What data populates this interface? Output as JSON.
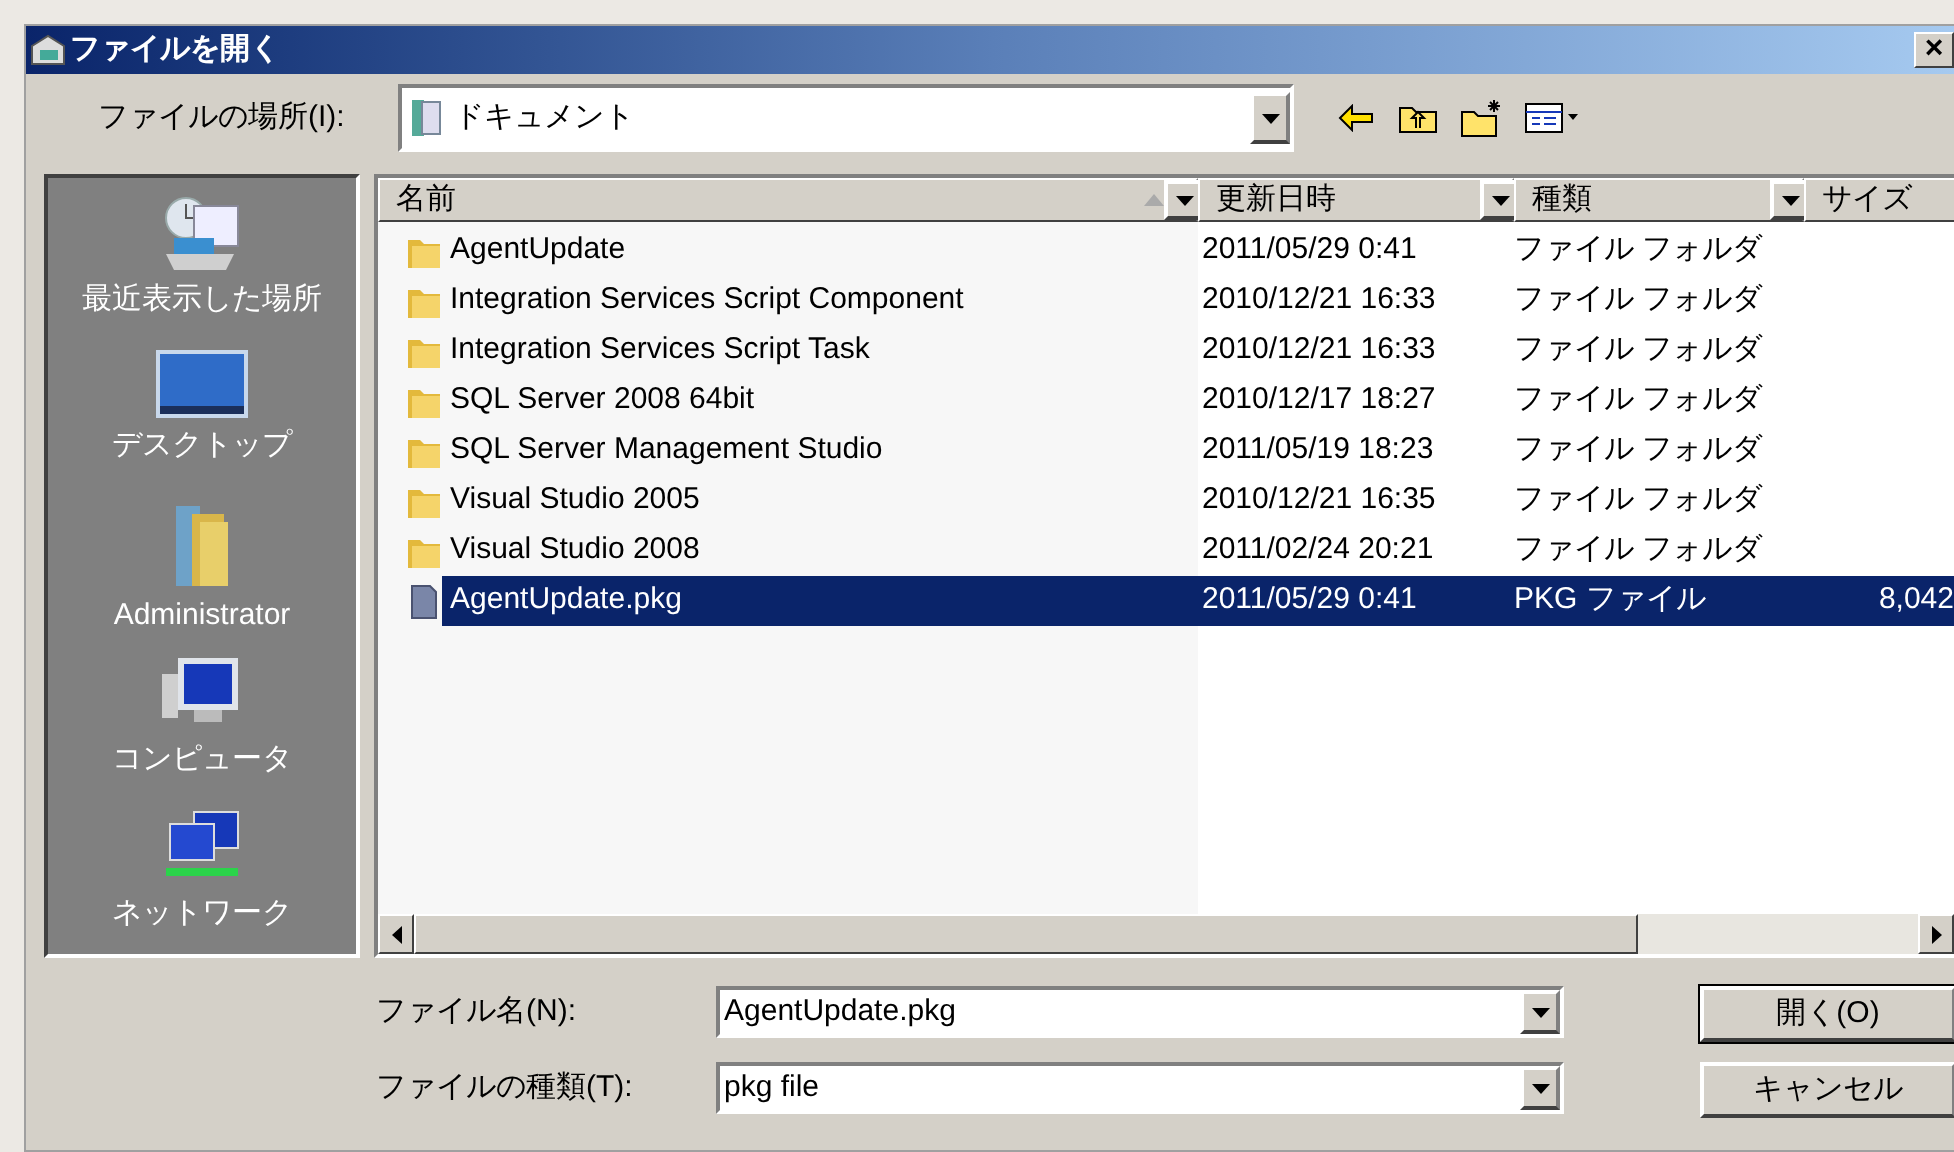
{
  "window": {
    "title": "ファイルを開く",
    "close": "×"
  },
  "location": {
    "label": "ファイルの場所(I):",
    "value": "ドキュメント"
  },
  "places": [
    {
      "kind": "recent",
      "label": "最近表示した場所"
    },
    {
      "kind": "desktop",
      "label": "デスクトップ"
    },
    {
      "kind": "user",
      "label": "Administrator"
    },
    {
      "kind": "computer",
      "label": "コンピュータ"
    },
    {
      "kind": "network",
      "label": "ネットワーク"
    }
  ],
  "columns": [
    {
      "label": "名前",
      "sorted": true
    },
    {
      "label": "更新日時",
      "sorted": false
    },
    {
      "label": "種類",
      "sorted": false
    },
    {
      "label": "サイズ",
      "sorted": false
    }
  ],
  "rows": [
    {
      "kind": "folder",
      "name": "AgentUpdate",
      "date": "2011/05/29 0:41",
      "type": "ファイル フォルダ",
      "selected": false
    },
    {
      "kind": "folder",
      "name": "Integration Services Script Component",
      "date": "2010/12/21 16:33",
      "type": "ファイル フォルダ",
      "selected": false
    },
    {
      "kind": "folder",
      "name": "Integration Services Script Task",
      "date": "2010/12/21 16:33",
      "type": "ファイル フォルダ",
      "selected": false
    },
    {
      "kind": "folder",
      "name": "SQL Server 2008 64bit",
      "date": "2010/12/17 18:27",
      "type": "ファイル フォルダ",
      "selected": false
    },
    {
      "kind": "folder",
      "name": "SQL Server Management Studio",
      "date": "2011/05/19 18:23",
      "type": "ファイル フォルダ",
      "selected": false
    },
    {
      "kind": "folder",
      "name": "Visual Studio 2005",
      "date": "2010/12/21 16:35",
      "type": "ファイル フォルダ",
      "selected": false
    },
    {
      "kind": "folder",
      "name": "Visual Studio 2008",
      "date": "2011/02/24 20:21",
      "type": "ファイル フォルダ",
      "selected": false
    },
    {
      "kind": "file",
      "name": "AgentUpdate.pkg",
      "date": "2011/05/29 0:41",
      "type": "PKG ファイル",
      "size": "8,042",
      "selected": true
    }
  ],
  "file_name": {
    "label": "ファイル名(N):",
    "value": "AgentUpdate.pkg"
  },
  "file_type": {
    "label": "ファイルの種類(T):",
    "value": "pkg file"
  },
  "buttons": [
    "開く(O)",
    "キャンセル"
  ]
}
